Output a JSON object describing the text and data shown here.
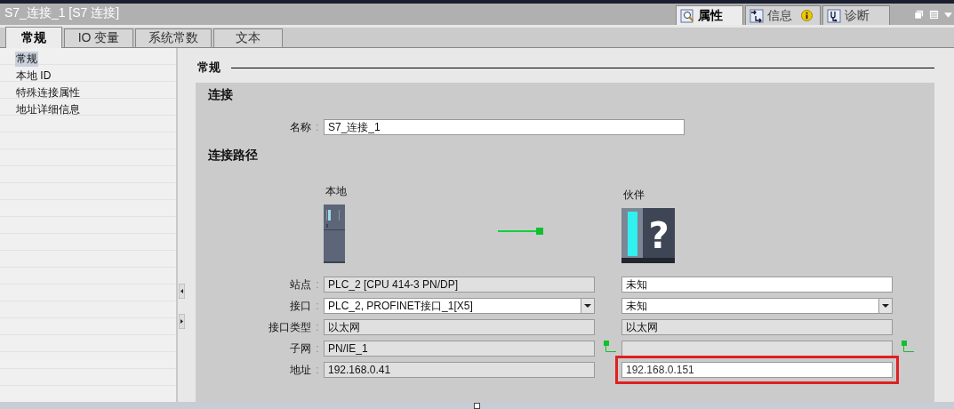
{
  "window": {
    "title": "S7_连接_1 [S7 连接]"
  },
  "inspector_tabs": [
    {
      "label": "属性",
      "selected": true,
      "kind": "properties"
    },
    {
      "label": "信息",
      "selected": false,
      "kind": "info",
      "notice": true
    },
    {
      "label": "诊断",
      "selected": false,
      "kind": "diagnostics"
    }
  ],
  "tabs": [
    {
      "label": "常规",
      "selected": true
    },
    {
      "label": "IO 变量",
      "selected": false
    },
    {
      "label": "系统常数",
      "selected": false
    },
    {
      "label": "文本",
      "selected": false
    }
  ],
  "sidebar": {
    "items": [
      {
        "label": "常规",
        "selected": true
      },
      {
        "label": "本地 ID",
        "selected": false
      },
      {
        "label": "特殊连接属性",
        "selected": false
      },
      {
        "label": "地址详细信息",
        "selected": false
      }
    ]
  },
  "section": {
    "title": "常规",
    "connection": {
      "title": "连接",
      "name_label": "名称",
      "colon": ":",
      "name_value": "S7_连接_1"
    },
    "path": {
      "title": "连接路径",
      "local_heading": "本地",
      "partner_heading": "伙伴",
      "partner_symbol": "?",
      "rows": [
        {
          "label": "站点",
          "colon": ":",
          "kind": "text",
          "local": {
            "value": "PLC_2 [CPU 414-3 PN/DP]",
            "editable": false
          },
          "partner": {
            "value": "未知",
            "editable": true
          }
        },
        {
          "label": "接口",
          "colon": ":",
          "kind": "dropdown",
          "local": {
            "value": "PLC_2, PROFINET接口_1[X5]",
            "editable": true
          },
          "partner": {
            "value": "未知",
            "editable": true
          }
        },
        {
          "label": "接口类型",
          "colon": ":",
          "kind": "text",
          "local": {
            "value": "以太网",
            "editable": false
          },
          "partner": {
            "value": "以太网",
            "editable": false
          }
        },
        {
          "label": "子网",
          "colon": ":",
          "kind": "subnet",
          "local": {
            "value": "PN/IE_1",
            "editable": false
          },
          "partner": {
            "editable": false
          }
        },
        {
          "label": "地址",
          "colon": ":",
          "kind": "text",
          "local": {
            "value": "192.168.0.41",
            "editable": false
          },
          "partner": {
            "value": "192.168.0.151",
            "editable": true,
            "highlighted": true
          }
        }
      ]
    }
  }
}
